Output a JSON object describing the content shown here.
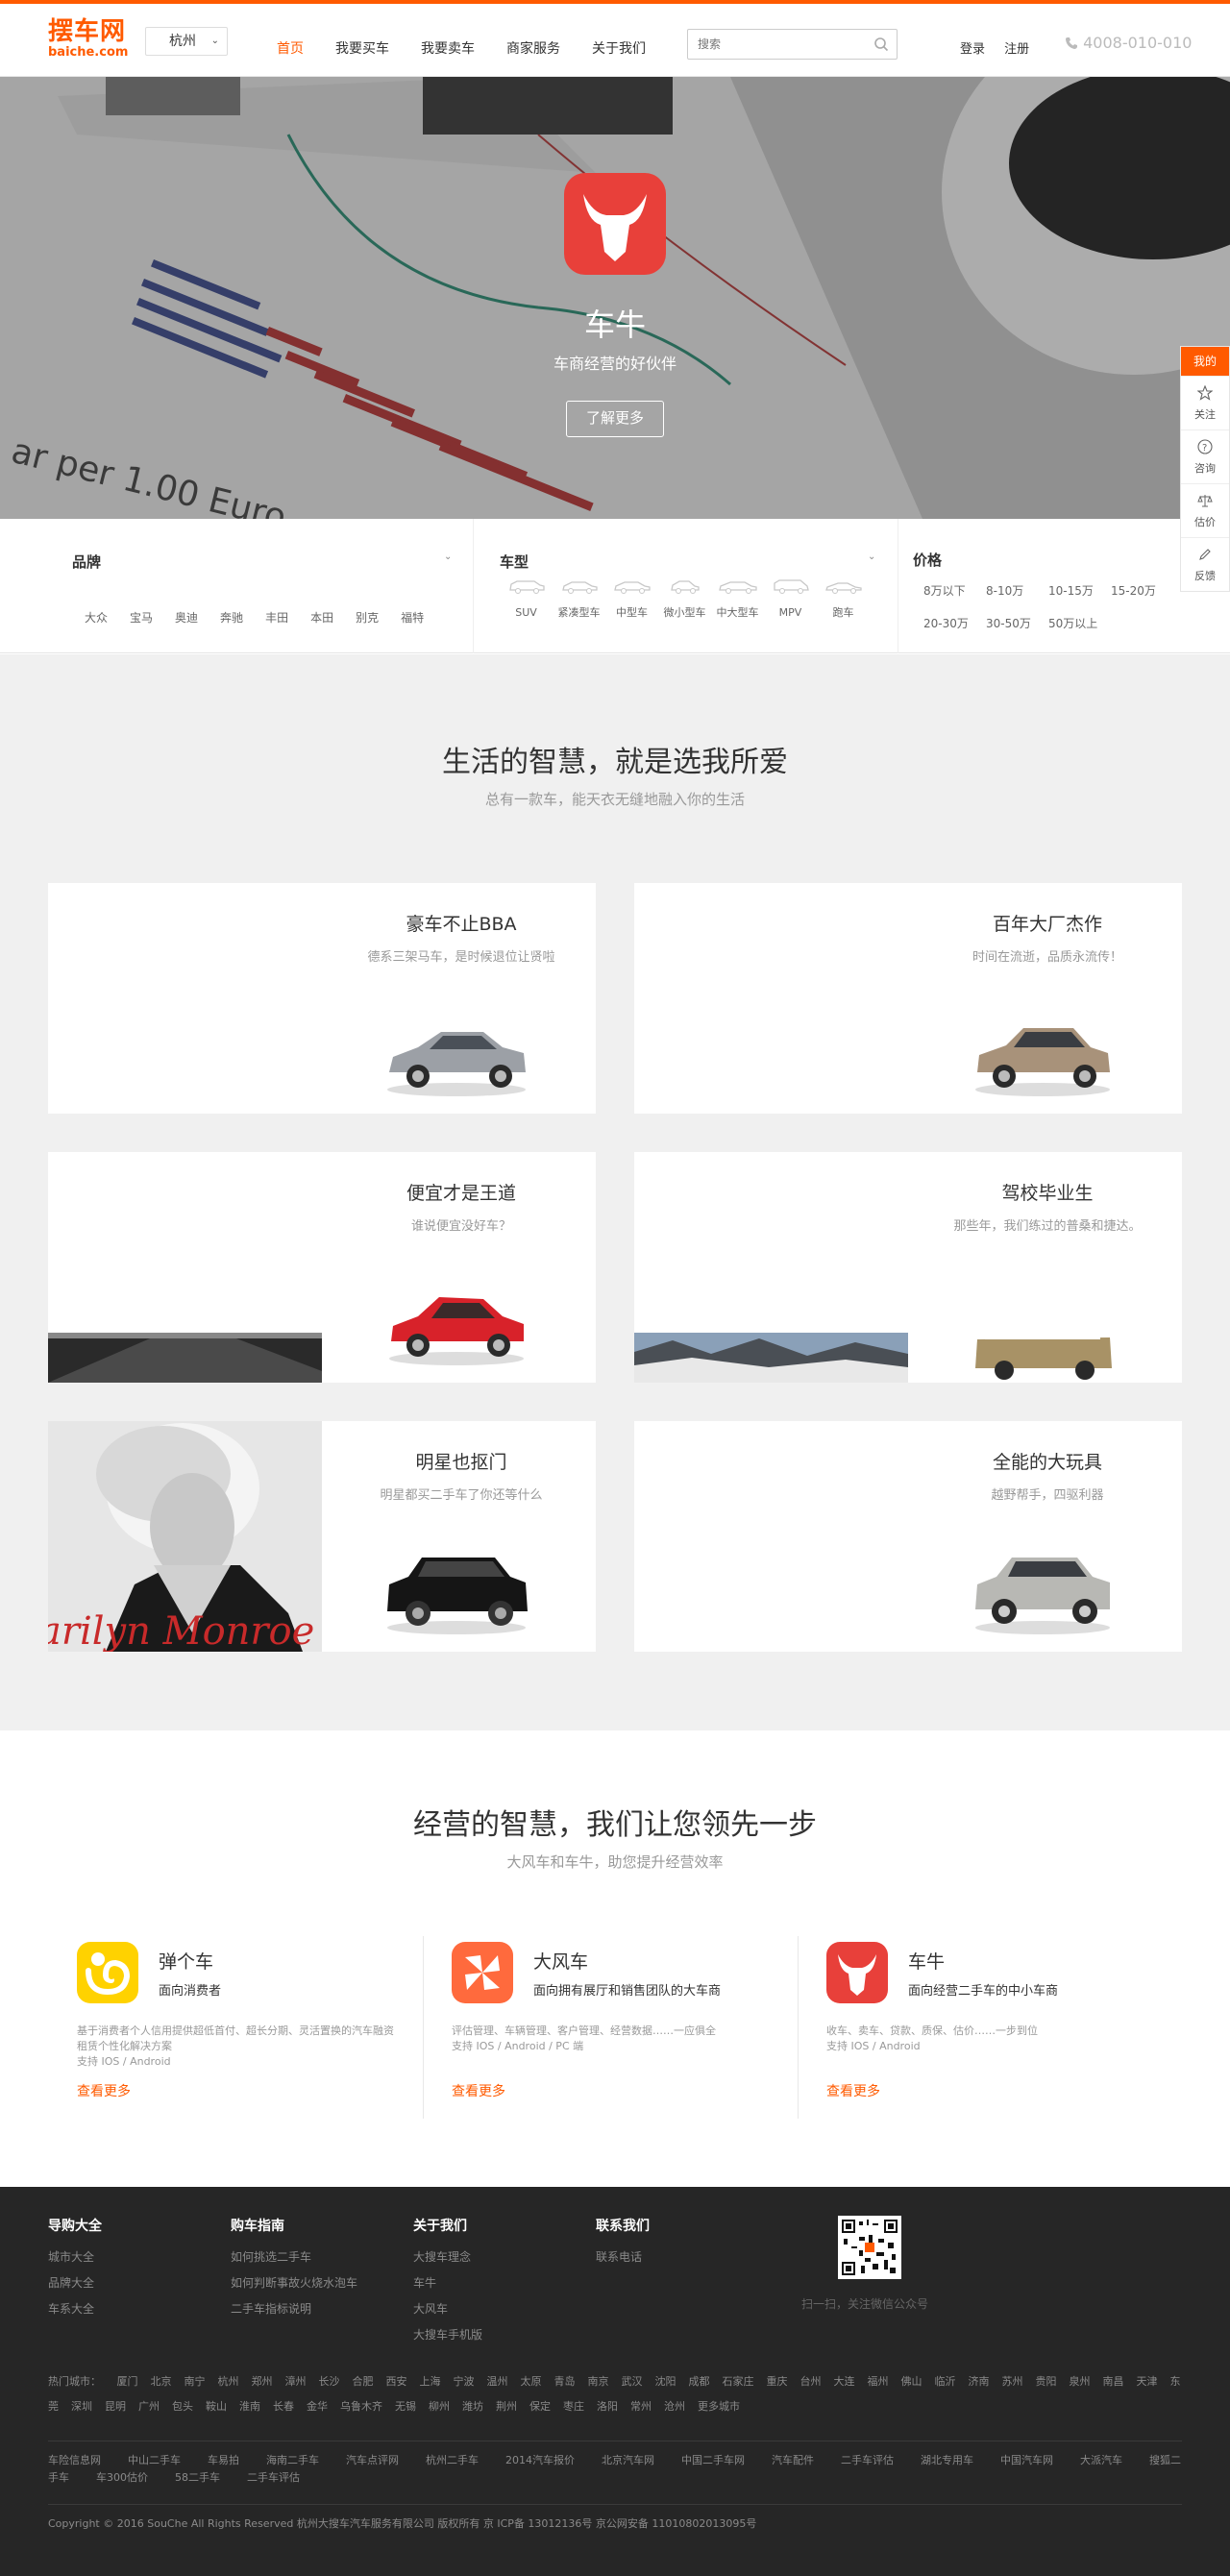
{
  "header": {
    "logo_main": "摆车网",
    "logo_sub": "baiche.com",
    "city": "杭州",
    "nav": [
      "首页",
      "我要买车",
      "我要卖车",
      "商家服务",
      "关于我们"
    ],
    "search_placeholder": "搜索",
    "login": "登录",
    "register": "注册",
    "phone": "4008-010-010"
  },
  "hero": {
    "title": "车牛",
    "subtitle": "车商经营的好伙伴",
    "button": "了解更多",
    "chart_text": "ar per 1.00 Euro"
  },
  "filter": {
    "brand_title": "品牌",
    "brands": [
      "大众",
      "宝马",
      "奥迪",
      "奔驰",
      "丰田",
      "本田",
      "别克",
      "福特"
    ],
    "type_title": "车型",
    "types": [
      "SUV",
      "紧凑型车",
      "中型车",
      "微小型车",
      "中大型车",
      "MPV",
      "跑车"
    ],
    "price_title": "价格",
    "prices": [
      "8万以下",
      "8-10万",
      "10-15万",
      "15-20万",
      "20-30万",
      "30-50万",
      "50万以上"
    ]
  },
  "section1": {
    "title": "生活的智慧，就是选我所爱",
    "subtitle": "总有一款车，能天衣无缝地融入你的生活",
    "cards": [
      {
        "title": "豪车不止BBA",
        "sub": "德系三架马车，是时候退位让贤啦"
      },
      {
        "title": "百年大厂杰作",
        "sub": "时间在流逝，品质永流传！"
      },
      {
        "title": "便宜才是王道",
        "sub": "谁说便宜没好车？"
      },
      {
        "title": "驾校毕业生",
        "sub": "那些年，我们练过的普桑和捷达。"
      },
      {
        "title": "明星也抠门",
        "sub": "明星都买二手车了你还等什么"
      },
      {
        "title": "全能的大玩具",
        "sub": "越野帮手，四驱利器"
      }
    ],
    "photo_text": "arilyn Monroe"
  },
  "section2": {
    "title": "经营的智慧，我们让您领先一步",
    "subtitle": "大风车和车牛，助您提升经营效率",
    "products": [
      {
        "name": "弹个车",
        "desc": "面向消费者",
        "text": "基于消费者个人信用提供超低首付、超长分期、灵活置换的汽车融资租赁个性化解决方案",
        "platforms": "支持 IOS / Android",
        "more": "查看更多",
        "color": "#ffd200"
      },
      {
        "name": "大风车",
        "desc": "面向拥有展厅和销售团队的大车商",
        "text": "评估管理、车辆管理、客户管理、经营数据……一应俱全",
        "platforms": "支持 IOS / Android / PC 端",
        "more": "查看更多",
        "color": "#ff6a3d"
      },
      {
        "name": "车牛",
        "desc": "面向经营二手车的中小车商",
        "text": "收车、卖车、贷款、质保、估价……一步到位",
        "platforms": "支持 IOS / Android",
        "more": "查看更多",
        "color": "#e8403a"
      }
    ]
  },
  "footer": {
    "groups": [
      {
        "title": "导购大全",
        "links": [
          "城市大全",
          "品牌大全",
          "车系大全"
        ]
      },
      {
        "title": "购车指南",
        "links": [
          "如何挑选二手车",
          "如何判断事故火烧水泡车",
          "二手车指标说明"
        ]
      },
      {
        "title": "关于我们",
        "links": [
          "大搜车理念",
          "车牛",
          "大风车",
          "大搜车手机版"
        ]
      },
      {
        "title": "联系我们",
        "links": [
          "联系电话"
        ]
      }
    ],
    "qr_caption": "扫一扫，关注微信公众号",
    "hot_label": "热门城市：",
    "hot_cities": [
      "厦门",
      "北京",
      "南宁",
      "杭州",
      "郑州",
      "漳州",
      "长沙",
      "合肥",
      "西安",
      "上海",
      "宁波",
      "温州",
      "太原",
      "青岛",
      "南京",
      "武汉",
      "沈阳",
      "成都",
      "石家庄",
      "重庆",
      "台州",
      "大连",
      "福州",
      "佛山",
      "临沂",
      "济南",
      "苏州",
      "贵阳",
      "泉州",
      "南昌",
      "天津",
      "东莞",
      "深圳",
      "昆明",
      "广州",
      "包头",
      "鞍山",
      "淮南",
      "长春",
      "金华",
      "乌鲁木齐",
      "无锡",
      "柳州",
      "潍坊",
      "荆州",
      "保定",
      "枣庄",
      "洛阳",
      "常州",
      "沧州",
      "更多城市"
    ],
    "partner_links": [
      "车险信息网",
      "中山二手车",
      "车易拍",
      "海南二手车",
      "汽车点评网",
      "杭州二手车",
      "2014汽车报价",
      "北京汽车网",
      "中国二手车网",
      "汽车配件",
      "二手车评估",
      "湖北专用车",
      "中国汽车网",
      "大派汽车",
      "搜狐二手车",
      "车300估价",
      "58二手车",
      "二手车评估"
    ],
    "copyright": "Copyright © 2016 SouChe All Rights Reserved 杭州大搜车汽车服务有限公司 版权所有 京 ICP备 13012136号 京公网安备 11010802013095号"
  },
  "sidebar": {
    "head": "我的",
    "items": [
      {
        "label": "关注",
        "icon": "star-icon"
      },
      {
        "label": "咨询",
        "icon": "question-icon"
      },
      {
        "label": "估价",
        "icon": "scale-icon"
      },
      {
        "label": "反馈",
        "icon": "edit-icon"
      }
    ]
  },
  "colors": {
    "accent": "#ff5a00",
    "footer_bg": "#262626",
    "section_bg": "#f0f0f0"
  }
}
